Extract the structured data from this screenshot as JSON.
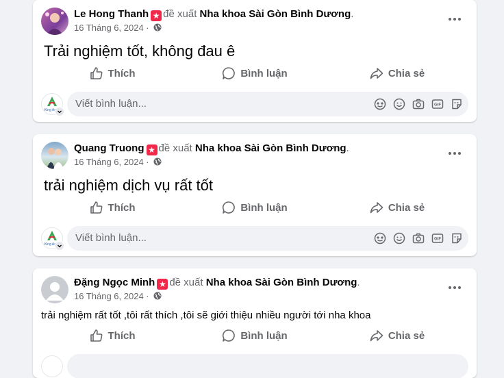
{
  "posts": [
    {
      "author": "Le Hong Thanh",
      "verb": "đề xuất",
      "page": "Nha khoa Sài Gòn Bình Dương",
      "period": ".",
      "date": "16 Tháng 6, 2024 ·",
      "text": "Trải nghiệm tốt, không đau ê"
    },
    {
      "author": "Quang Truong",
      "verb": "đề xuất",
      "page": "Nha khoa Sài Gòn Bình Dương",
      "period": ".",
      "date": "16 Tháng 6, 2024 ·",
      "text": "trải nghiệm dịch vụ rất tốt"
    },
    {
      "author": "Đặng Ngọc Minh",
      "verb": "đề xuất",
      "page": "Nha khoa Sài Gòn Bình Dương",
      "period": ".",
      "date": "16 Tháng 6, 2024 ·",
      "text": "trải nghiệm rất tốt ,tôi rất thích ,tôi sẽ giới thiệu nhiều người tới nha khoa"
    }
  ],
  "actions": {
    "like": "Thích",
    "comment": "Bình luận",
    "share": "Chia sẻ"
  },
  "comment_placeholder": "Viết bình luận...",
  "brand_logo_text": "King Asen",
  "colors": {
    "recommend_badge": "#f02849",
    "secondary_text": "#65676b",
    "background": "#f0f2f5"
  },
  "icons": [
    "recommend-star-icon",
    "globe-icon",
    "more-options-icon",
    "like-icon",
    "comment-icon",
    "share-icon",
    "avatar-icon",
    "emoji-icon",
    "camera-icon",
    "gif-icon",
    "sticker-icon"
  ]
}
